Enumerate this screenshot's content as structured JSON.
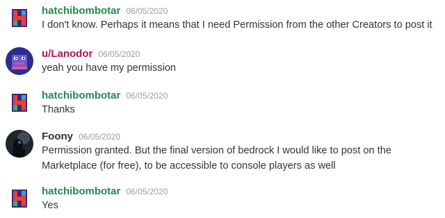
{
  "colors": {
    "green_username": "#1f8b4c",
    "pink_username": "#ad1457",
    "dark_username": "#2e3338",
    "timestamp": "#9a9ca1",
    "text": "#2e3338"
  },
  "messages": [
    {
      "author": "hatchibombotar",
      "timestamp": "06/05/2020",
      "avatar_icon": "hatchibombotar-h-logo-icon",
      "text": "I don't know. Perhaps it means that I need Permission from the other Creators to post it"
    },
    {
      "author": "u/Lanodor",
      "timestamp": "06/05/2020",
      "avatar_icon": "lanodor-creature-avatar-icon",
      "text": "yeah you have my permission"
    },
    {
      "author": "hatchibombotar",
      "timestamp": "06/05/2020",
      "avatar_icon": "hatchibombotar-h-logo-icon",
      "text": "Thanks"
    },
    {
      "author": "Foony",
      "timestamp": "06/05/2020",
      "avatar_icon": "foony-dark-figure-avatar-icon",
      "text_line1": "Permission granted. But the final version of bedrock I would like to post on the",
      "text_line2": "Marketplace (for free), to be accessible to console players as well"
    },
    {
      "author": "hatchibombotar",
      "timestamp": "06/05/2020",
      "avatar_icon": "hatchibombotar-h-logo-icon",
      "text": "Yes"
    }
  ]
}
